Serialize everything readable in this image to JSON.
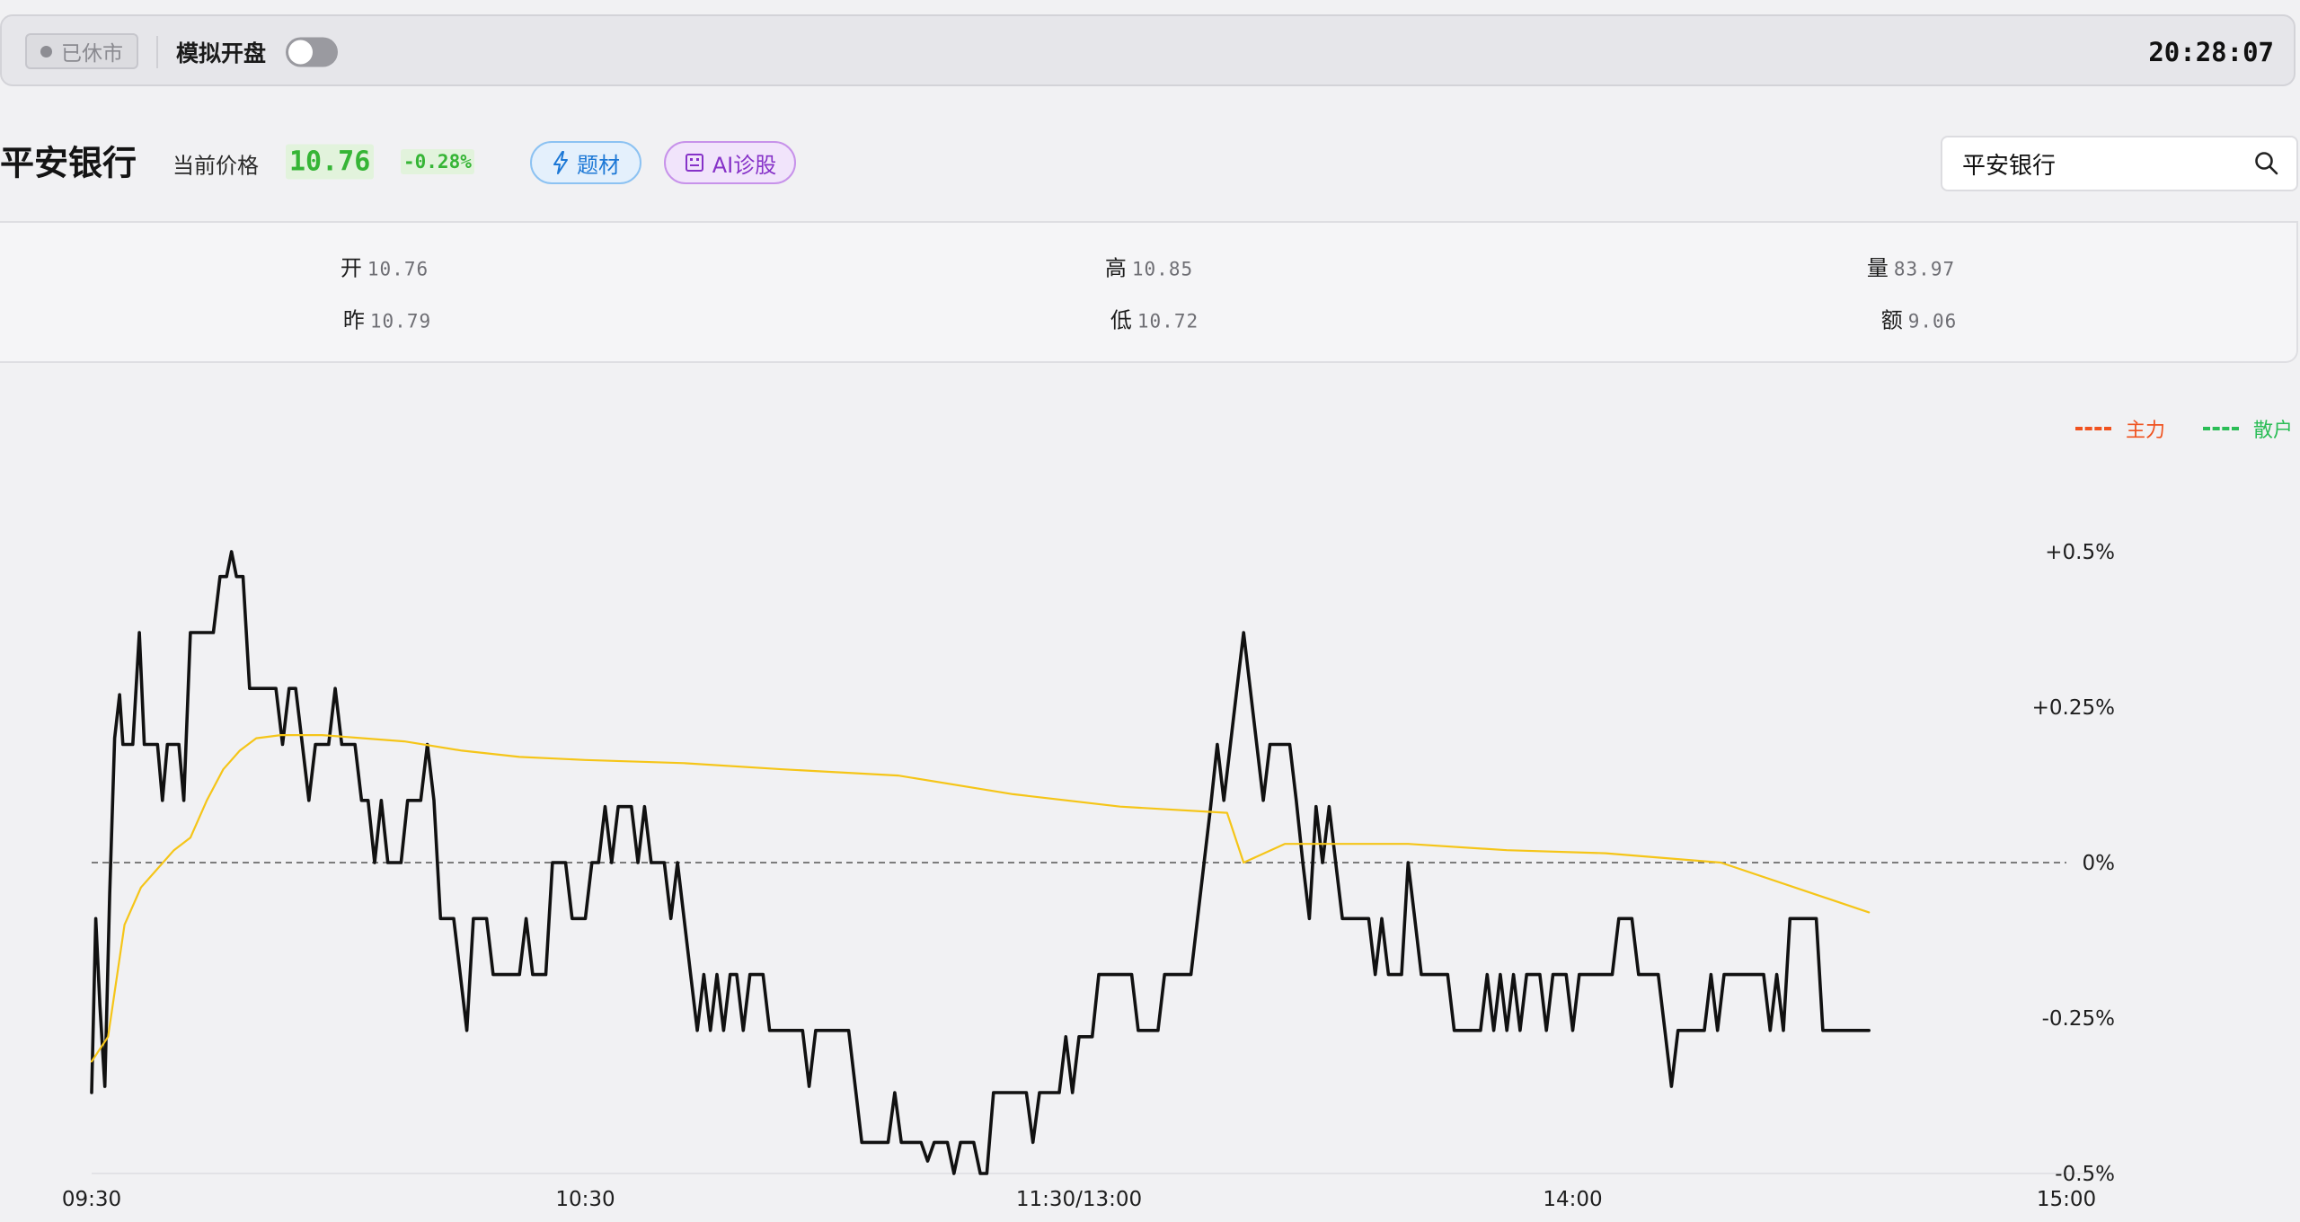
{
  "topbar": {
    "status_label": "已休市",
    "sim_label": "模拟开盘",
    "sim_toggle_on": false,
    "clock": "20:28:07"
  },
  "stock": {
    "name": "平安银行",
    "price_label": "当前价格",
    "price": "10.76",
    "change": "-0.28%",
    "theme_button": "题材",
    "ai_button": "AI诊股"
  },
  "search": {
    "value": "平安银行"
  },
  "stats": {
    "open": {
      "label": "开",
      "value": "10.76"
    },
    "high": {
      "label": "高",
      "value": "10.85"
    },
    "volume": {
      "label": "量",
      "value": "83.97"
    },
    "prev": {
      "label": "昨",
      "value": "10.79"
    },
    "low": {
      "label": "低",
      "value": "10.72"
    },
    "amount": {
      "label": "额",
      "value": "9.06"
    }
  },
  "legend": {
    "main": {
      "label": "主力",
      "color": "#f0521f"
    },
    "retail": {
      "label": "散户",
      "color": "#2bbd56"
    }
  },
  "colors": {
    "price_up": "#36b536",
    "price_line": "#111111",
    "avg_line": "#f5c518"
  },
  "chart_data": {
    "type": "line",
    "x_labels": [
      "09:30",
      "10:30",
      "11:30/13:00",
      "14:00",
      "15:00"
    ],
    "y_tick_labels": [
      "+0.5%",
      "+0.25%",
      "0%",
      "-0.25%",
      "-0.5%"
    ],
    "y_ticks": [
      0.5,
      0.25,
      0,
      -0.25,
      -0.5
    ],
    "ylim": [
      -0.5,
      0.5
    ],
    "x_range_minutes": [
      0,
      240
    ],
    "baseline": 0,
    "series": [
      {
        "role": "price",
        "color": "#111111",
        "points": [
          [
            0,
            -0.37
          ],
          [
            0.5,
            -0.09
          ],
          [
            1,
            -0.23
          ],
          [
            1.6,
            -0.36
          ],
          [
            2.2,
            -0.05
          ],
          [
            2.8,
            0.2
          ],
          [
            3.4,
            0.27
          ],
          [
            3.8,
            0.19
          ],
          [
            5,
            0.19
          ],
          [
            5.8,
            0.37
          ],
          [
            6.4,
            0.19
          ],
          [
            8,
            0.19
          ],
          [
            8.6,
            0.1
          ],
          [
            9.2,
            0.19
          ],
          [
            10.6,
            0.19
          ],
          [
            11.2,
            0.1
          ],
          [
            12,
            0.37
          ],
          [
            14,
            0.37
          ],
          [
            14.8,
            0.37
          ],
          [
            15.6,
            0.46
          ],
          [
            16.4,
            0.46
          ],
          [
            17,
            0.5
          ],
          [
            17.6,
            0.46
          ],
          [
            18.4,
            0.46
          ],
          [
            19.2,
            0.28
          ],
          [
            22.4,
            0.28
          ],
          [
            23.2,
            0.19
          ],
          [
            24,
            0.28
          ],
          [
            24.8,
            0.28
          ],
          [
            25.6,
            0.19
          ],
          [
            26.4,
            0.1
          ],
          [
            27.2,
            0.19
          ],
          [
            28.8,
            0.19
          ],
          [
            29.6,
            0.28
          ],
          [
            30.4,
            0.19
          ],
          [
            32,
            0.19
          ],
          [
            32.8,
            0.1
          ],
          [
            33.6,
            0.1
          ],
          [
            34.4,
            0
          ],
          [
            35.2,
            0.1
          ],
          [
            36,
            0
          ],
          [
            37.6,
            0
          ],
          [
            38.4,
            0.1
          ],
          [
            40,
            0.1
          ],
          [
            40.8,
            0.19
          ],
          [
            41.6,
            0.1
          ],
          [
            42.4,
            -0.09
          ],
          [
            44,
            -0.09
          ],
          [
            44.8,
            -0.18
          ],
          [
            45.6,
            -0.27
          ],
          [
            46.4,
            -0.09
          ],
          [
            48,
            -0.09
          ],
          [
            48.8,
            -0.18
          ],
          [
            52,
            -0.18
          ],
          [
            52.8,
            -0.09
          ],
          [
            53.6,
            -0.18
          ],
          [
            55.2,
            -0.18
          ],
          [
            56,
            0
          ],
          [
            57.6,
            0
          ],
          [
            58.4,
            -0.09
          ],
          [
            60,
            -0.09
          ],
          [
            60.8,
            0
          ],
          [
            61.6,
            0
          ],
          [
            62.4,
            0.09
          ],
          [
            63.2,
            0
          ],
          [
            64,
            0.09
          ],
          [
            65.6,
            0.09
          ],
          [
            66.4,
            0
          ],
          [
            67.2,
            0.09
          ],
          [
            68,
            0
          ],
          [
            69.6,
            0
          ],
          [
            70.4,
            -0.09
          ],
          [
            71.2,
            0
          ],
          [
            72,
            -0.09
          ],
          [
            72.8,
            -0.18
          ],
          [
            73.6,
            -0.27
          ],
          [
            74.4,
            -0.18
          ],
          [
            75.2,
            -0.27
          ],
          [
            76,
            -0.18
          ],
          [
            76.8,
            -0.27
          ],
          [
            77.6,
            -0.18
          ],
          [
            78.4,
            -0.18
          ],
          [
            79.2,
            -0.27
          ],
          [
            80,
            -0.18
          ],
          [
            81.6,
            -0.18
          ],
          [
            82.4,
            -0.27
          ],
          [
            86.4,
            -0.27
          ],
          [
            87.2,
            -0.36
          ],
          [
            88,
            -0.27
          ],
          [
            92,
            -0.27
          ],
          [
            92.8,
            -0.36
          ],
          [
            93.6,
            -0.45
          ],
          [
            96.8,
            -0.45
          ],
          [
            97.6,
            -0.37
          ],
          [
            98.4,
            -0.45
          ],
          [
            100.8,
            -0.45
          ],
          [
            101.6,
            -0.48
          ],
          [
            102.4,
            -0.45
          ],
          [
            104,
            -0.45
          ],
          [
            104.8,
            -0.5
          ],
          [
            105.6,
            -0.45
          ],
          [
            107.2,
            -0.45
          ],
          [
            108,
            -0.5
          ],
          [
            108.8,
            -0.5
          ],
          [
            109.6,
            -0.37
          ],
          [
            113.6,
            -0.37
          ],
          [
            114.4,
            -0.45
          ],
          [
            115.2,
            -0.37
          ],
          [
            117.6,
            -0.37
          ],
          [
            118.4,
            -0.28
          ],
          [
            119.2,
            -0.37
          ],
          [
            120,
            -0.28
          ],
          [
            121.6,
            -0.28
          ],
          [
            122.4,
            -0.18
          ],
          [
            126.4,
            -0.18
          ],
          [
            127.2,
            -0.27
          ],
          [
            129.6,
            -0.27
          ],
          [
            130.4,
            -0.18
          ],
          [
            133.6,
            -0.18
          ],
          [
            134.4,
            -0.09
          ],
          [
            135.2,
            0
          ],
          [
            136,
            0.09
          ],
          [
            136.8,
            0.19
          ],
          [
            137.6,
            0.1
          ],
          [
            138.4,
            0.19
          ],
          [
            139.2,
            0.28
          ],
          [
            140,
            0.37
          ],
          [
            140.8,
            0.28
          ],
          [
            141.6,
            0.19
          ],
          [
            142.4,
            0.1
          ],
          [
            143.2,
            0.19
          ],
          [
            145.6,
            0.19
          ],
          [
            146.4,
            0.1
          ],
          [
            147.2,
            0
          ],
          [
            148,
            -0.09
          ],
          [
            148.8,
            0.09
          ],
          [
            149.6,
            0
          ],
          [
            150.4,
            0.09
          ],
          [
            151.2,
            0
          ],
          [
            152,
            -0.09
          ],
          [
            155.2,
            -0.09
          ],
          [
            156,
            -0.18
          ],
          [
            156.8,
            -0.09
          ],
          [
            157.6,
            -0.18
          ],
          [
            159.2,
            -0.18
          ],
          [
            160,
            0
          ],
          [
            160.8,
            -0.09
          ],
          [
            161.6,
            -0.18
          ],
          [
            164.8,
            -0.18
          ],
          [
            165.6,
            -0.27
          ],
          [
            168.8,
            -0.27
          ],
          [
            169.6,
            -0.18
          ],
          [
            170.4,
            -0.27
          ],
          [
            171.2,
            -0.18
          ],
          [
            172,
            -0.27
          ],
          [
            172.8,
            -0.18
          ],
          [
            173.6,
            -0.27
          ],
          [
            174.4,
            -0.18
          ],
          [
            176,
            -0.18
          ],
          [
            176.8,
            -0.27
          ],
          [
            177.6,
            -0.18
          ],
          [
            179.2,
            -0.18
          ],
          [
            180,
            -0.27
          ],
          [
            180.8,
            -0.18
          ],
          [
            184.8,
            -0.18
          ],
          [
            185.6,
            -0.09
          ],
          [
            187.2,
            -0.09
          ],
          [
            188,
            -0.18
          ],
          [
            190.4,
            -0.18
          ],
          [
            191.2,
            -0.27
          ],
          [
            192,
            -0.36
          ],
          [
            192.8,
            -0.27
          ],
          [
            196,
            -0.27
          ],
          [
            196.8,
            -0.18
          ],
          [
            197.6,
            -0.27
          ],
          [
            198.4,
            -0.18
          ],
          [
            203.2,
            -0.18
          ],
          [
            204,
            -0.27
          ],
          [
            204.8,
            -0.18
          ],
          [
            205.6,
            -0.27
          ],
          [
            206.4,
            -0.09
          ],
          [
            209.6,
            -0.09
          ],
          [
            210.4,
            -0.27
          ],
          [
            216,
            -0.27
          ]
        ]
      },
      {
        "role": "average",
        "color": "#f5c518",
        "points": [
          [
            0,
            -0.32
          ],
          [
            2,
            -0.28
          ],
          [
            4,
            -0.1
          ],
          [
            6,
            -0.04
          ],
          [
            8,
            -0.01
          ],
          [
            10,
            0.02
          ],
          [
            12,
            0.04
          ],
          [
            14,
            0.1
          ],
          [
            16,
            0.15
          ],
          [
            18,
            0.18
          ],
          [
            20,
            0.2
          ],
          [
            23,
            0.205
          ],
          [
            28,
            0.205
          ],
          [
            33,
            0.2
          ],
          [
            38,
            0.195
          ],
          [
            45,
            0.18
          ],
          [
            52,
            0.17
          ],
          [
            60,
            0.165
          ],
          [
            72,
            0.16
          ],
          [
            84,
            0.15
          ],
          [
            98,
            0.14
          ],
          [
            112,
            0.11
          ],
          [
            125,
            0.09
          ],
          [
            138,
            0.08
          ],
          [
            140,
            0.0
          ],
          [
            145,
            0.03
          ],
          [
            152,
            0.03
          ],
          [
            160,
            0.03
          ],
          [
            172,
            0.02
          ],
          [
            184,
            0.015
          ],
          [
            198,
            0.0
          ],
          [
            216,
            -0.08
          ]
        ]
      }
    ]
  }
}
